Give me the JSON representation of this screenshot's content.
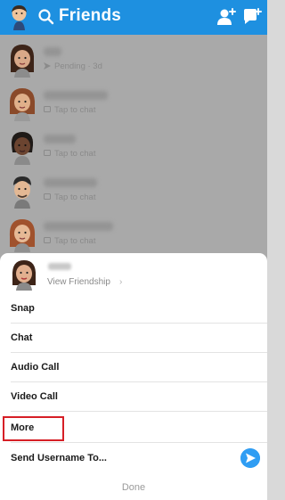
{
  "header": {
    "title": "Friends"
  },
  "friends_list": [
    {
      "status_icon": "arrow-icon",
      "status": "Pending · 3d"
    },
    {
      "status_icon": "chat-icon",
      "status": "Tap to chat"
    },
    {
      "status_icon": "chat-icon",
      "status": "Tap to chat"
    },
    {
      "status_icon": "chat-icon",
      "status": "Tap to chat"
    },
    {
      "status_icon": "chat-icon",
      "status": "Tap to chat"
    }
  ],
  "sheet": {
    "view_friendship": "View Friendship",
    "chevron": "›",
    "items": [
      {
        "label": "Snap"
      },
      {
        "label": "Chat"
      },
      {
        "label": "Audio Call"
      },
      {
        "label": "Video Call"
      },
      {
        "label": "More"
      },
      {
        "label": "Send Username To..."
      }
    ],
    "done": "Done"
  },
  "colors": {
    "header": "#1e90e0",
    "highlight_border": "#d61f26",
    "send_button": "#2f9df3"
  }
}
